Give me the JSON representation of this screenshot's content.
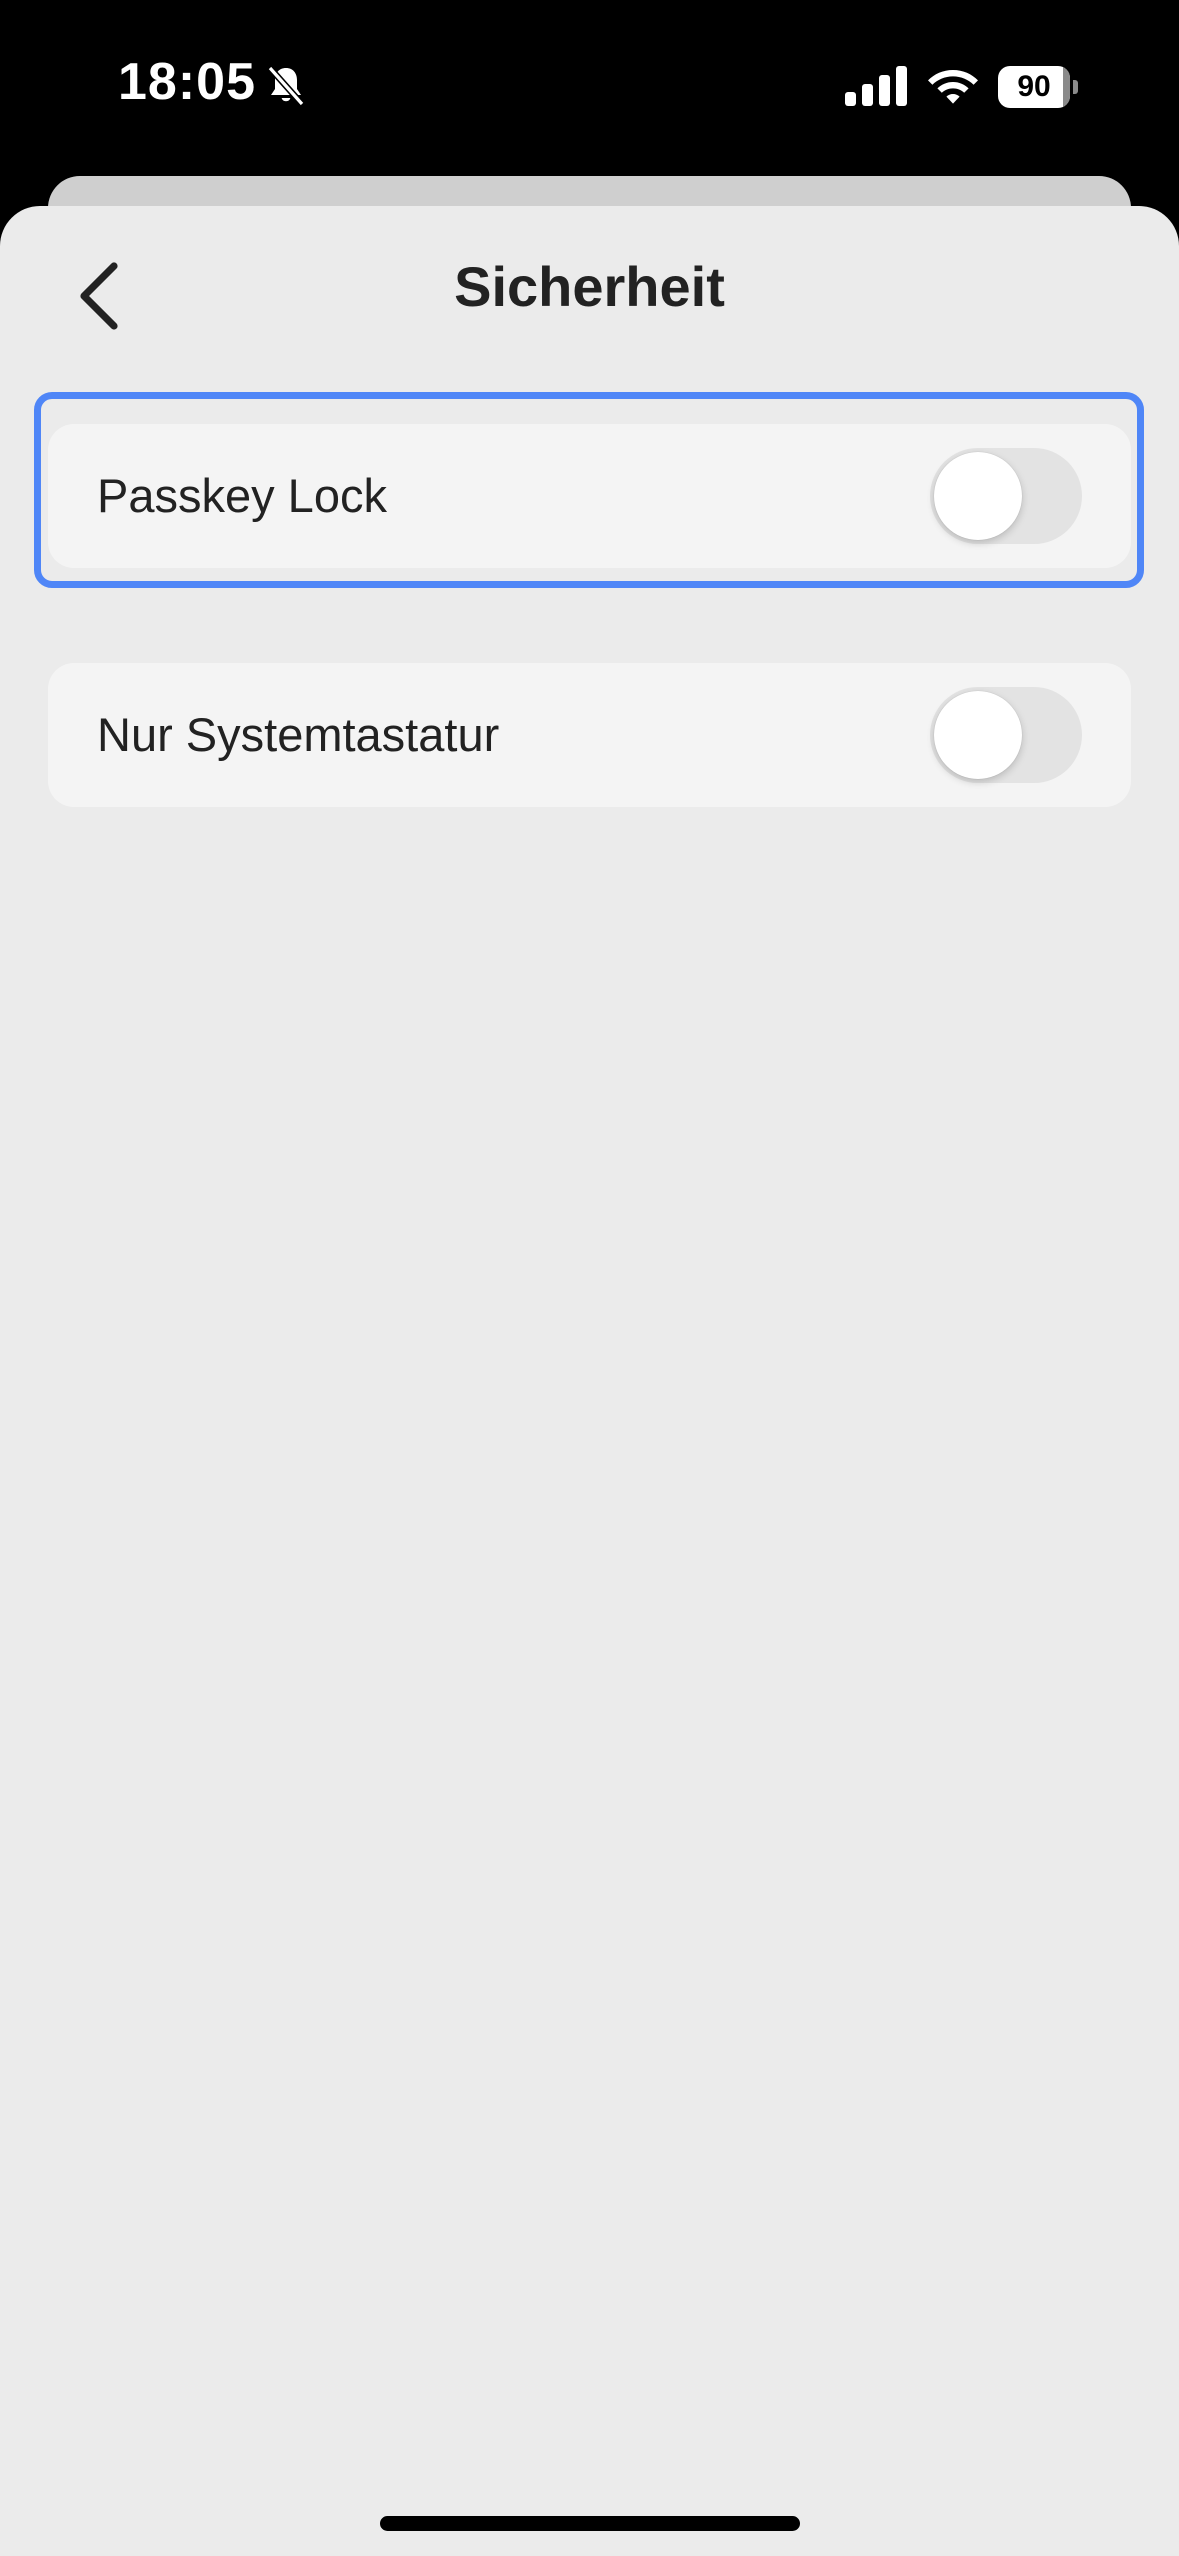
{
  "status_bar": {
    "time": "18:05",
    "battery_level": "90",
    "battery_fraction": 0.9,
    "icons": [
      "bell-slash-icon",
      "cellular-signal-icon",
      "wifi-icon",
      "battery-icon"
    ]
  },
  "header": {
    "title": "Sicherheit",
    "back_icon": "chevron-left-icon"
  },
  "settings": [
    {
      "label": "Passkey Lock",
      "enabled": false,
      "highlighted": true
    },
    {
      "label": "Nur Systemtastatur",
      "enabled": false,
      "highlighted": false
    }
  ],
  "colors": {
    "highlight": "#4f86f7",
    "background": "#ebebeb",
    "card": "#f4f4f4",
    "toggle_off": "#e3e3e3"
  }
}
